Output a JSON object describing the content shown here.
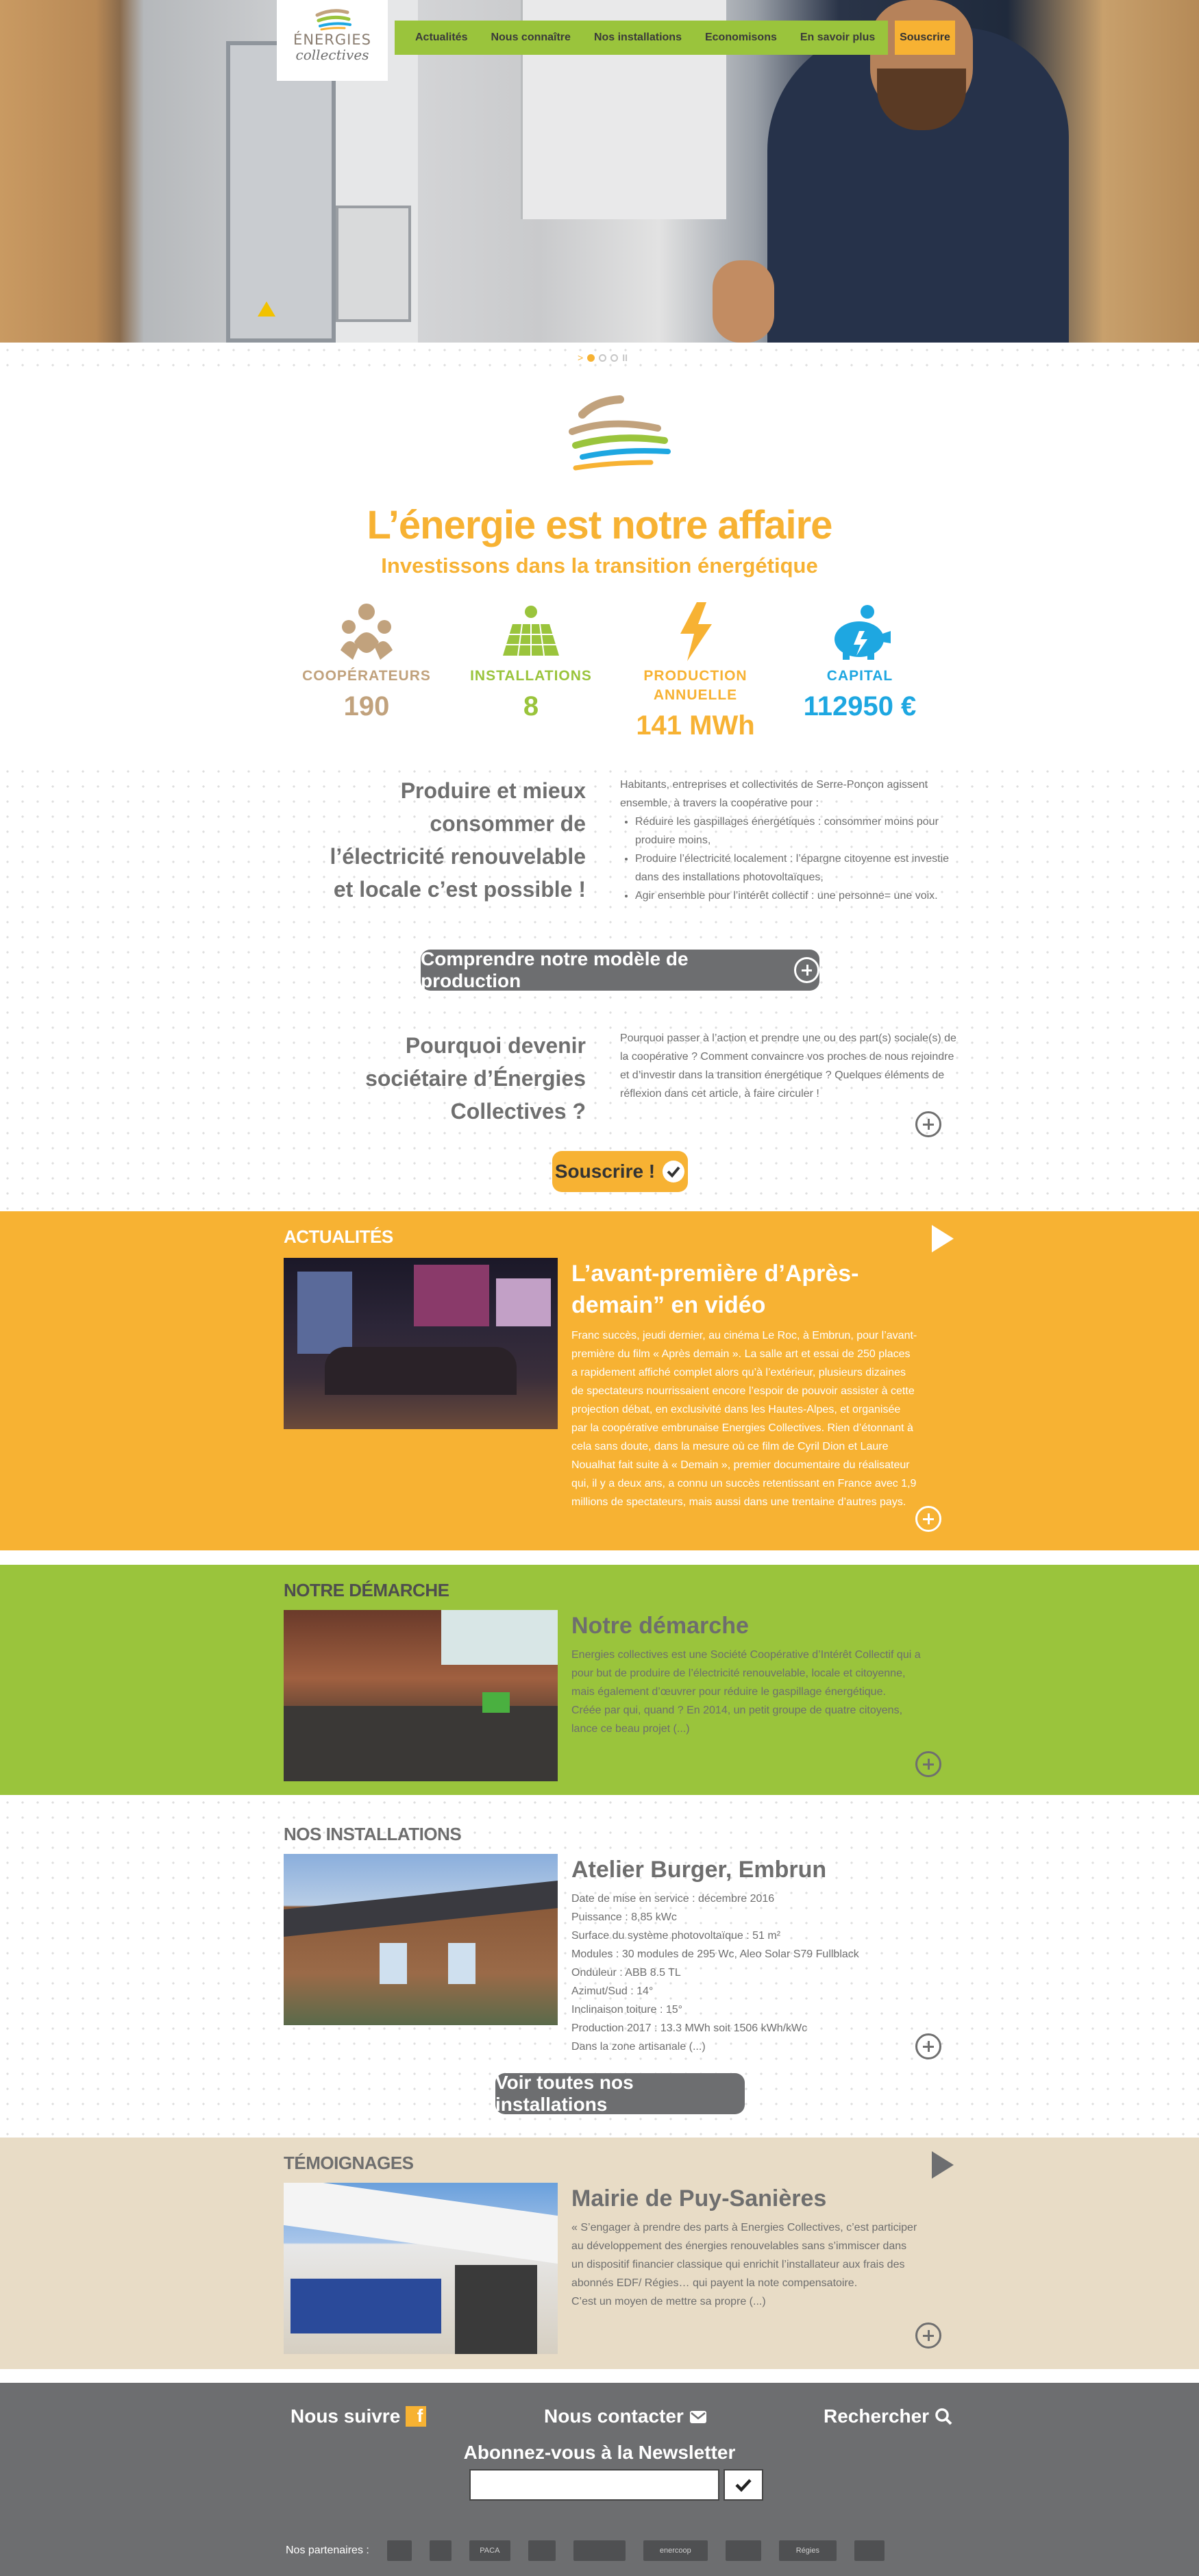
{
  "nav": {
    "logo_line1": "ÉNERGIES",
    "logo_line2": "collectives",
    "items": [
      "Actualités",
      "Nous connaître",
      "Nos installations",
      "Economisons",
      "En savoir plus"
    ],
    "subscribe": "Souscrire"
  },
  "slider": {
    "prev": ">",
    "pause": "II",
    "slide_count": 3,
    "active_slide": 1
  },
  "intro": {
    "title": "L’énergie est notre affaire",
    "subtitle": "Investissons dans la transition énergétique"
  },
  "stats": [
    {
      "label": "COOPÉRATEURS",
      "value": "190",
      "color": "#c1a27d",
      "icon": "people-icon"
    },
    {
      "label": "INSTALLATIONS",
      "value": "8",
      "color": "#9ac43c",
      "icon": "solar-panel-icon"
    },
    {
      "label": "PRODUCTION ANNUELLE",
      "value": "141 MWh",
      "color": "#f7b233",
      "icon": "lightning-icon"
    },
    {
      "label": "CAPITAL",
      "value": "112950 €",
      "color": "#1ea7e1",
      "icon": "piggy-bank-icon"
    }
  ],
  "produce": {
    "title": "Produire et mieux consommer de l’électricité renouvelable et locale c’est possible !",
    "intro": "Habitants, entreprises et collectivités de Serre-Ponçon agissent ensemble, à travers la coopérative pour :",
    "bullets": [
      "Réduire les gaspillages énergétiques : consommer moins pour produire moins,",
      "Produire l’électricité localement : l’épargne citoyenne est investie dans des installations photovoltaïques,",
      "Agir ensemble pour l’intérêt collectif : une personne= une voix."
    ],
    "button": "Comprendre notre modèle de production"
  },
  "why": {
    "title": "Pourquoi devenir sociétaire d’Énergies Collectives ?",
    "text": "Pourquoi passer à l’action et prendre une ou des part(s) sociale(s) de la coopérative ? Comment convaincre vos proches de nous rejoindre et d’investir dans la transition énergétique ? Quelques éléments de réflexion dans cet article, à faire circuler !",
    "button": "Souscrire !"
  },
  "news": {
    "label": "ACTUALITÉS",
    "title": "L’avant-première d’Après-demain” en vidéo",
    "text": "Franc succès, jeudi dernier, au cinéma Le Roc, à Embrun, pour l’avant-première du film « Après demain ». La salle art et essai de 250 places a rapidement affiché complet alors qu’à l’extérieur, plusieurs dizaines de spectateurs nourrissaient encore l’espoir de pouvoir assister à cette projection débat, en exclusivité dans les Hautes-Alpes, et organisée par la coopérative embrunaise Energies Collectives. Rien d’étonnant à cela sans doute, dans la mesure où ce film de Cyril Dion et Laure Noualhat fait suite à « Demain », premier documentaire du réalisateur qui, il y a deux ans, a connu un succès retentissant en France avec 1,9 millions de spectateurs, mais aussi dans une trentaine d’autres pays."
  },
  "approach": {
    "label": "NOTRE DÉMARCHE",
    "title": "Notre démarche",
    "text1": "Energies collectives est une Société Coopérative d’Intérêt Collectif qui a pour but de produire de l’électricité renouvelable, locale et citoyenne, mais également d’œuvrer pour réduire le gaspillage énergétique.",
    "text2": "Créée par qui, quand ? En 2014, un petit groupe de quatre citoyens, lance ce beau projet (...)"
  },
  "installations": {
    "label": "NOS INSTALLATIONS",
    "title": "Atelier Burger, Embrun",
    "lines": [
      "Date de mise en service : décembre 2016",
      "Puissance : 8,85 kWc",
      "Surface du système photovoltaïque : 51 m²",
      "Modules : 30 modules de 295 Wc, Aleo Solar S79 Fullblack",
      "Onduleur : ABB 8.5 TL",
      "Azimut/Sud : 14°",
      "Inclinaison toiture : 15°",
      "Production 2017 : 13.3 MWh soit 1506 kWh/kWc",
      "Dans la zone artisanale (...)"
    ],
    "button": "Voir toutes nos installations"
  },
  "testimonials": {
    "label": "TÉMOIGNAGES",
    "title": "Mairie de Puy-Sanières",
    "text1": "« S’engager à prendre des parts à Energies Collectives, c’est participer au développement des énergies renouvelables sans s’immiscer dans un dispositif financier classique qui enrichit l’installateur aux frais des abonnés EDF/ Régies… qui payent la note compensatoire.",
    "text2": "C’est un moyen de mettre sa propre (...)"
  },
  "footer": {
    "follow": "Nous suivre",
    "contact": "Nous contacter",
    "search": "Rechercher",
    "newsletter": "Abonnez-vous à la Newsletter",
    "partners_label": "Nos partenaires :",
    "partners": [
      "",
      "",
      "PACA",
      "",
      "",
      "enercoop",
      "",
      "Régies",
      ""
    ]
  },
  "colors": {
    "orange": "#f7b233",
    "green": "#9ac43c",
    "beige": "#e8dcc6",
    "grey": "#6d6e70",
    "blue": "#1ea7e1",
    "tan": "#c1a27d"
  }
}
